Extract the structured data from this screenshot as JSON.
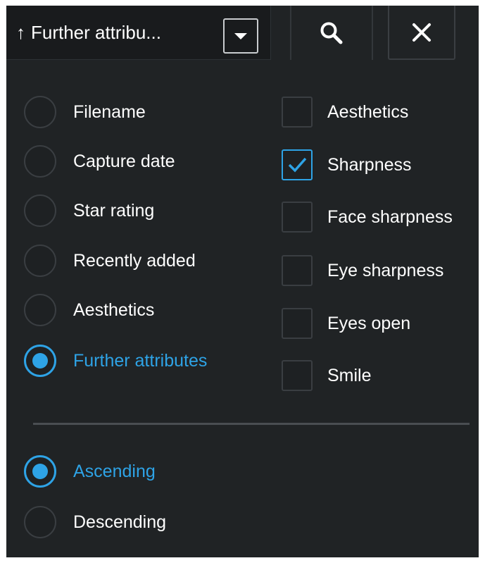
{
  "toolbar": {
    "sort_label": "Further attribu...",
    "arrow_glyph": "↑",
    "search_icon": "search-icon",
    "close_icon": "close-icon"
  },
  "sort_by": {
    "selected": "Further attributes",
    "options": [
      {
        "label": "Filename",
        "checked": false
      },
      {
        "label": "Capture date",
        "checked": false
      },
      {
        "label": "Star rating",
        "checked": false
      },
      {
        "label": "Recently added",
        "checked": false
      },
      {
        "label": "Aesthetics",
        "checked": false
      },
      {
        "label": "Further attributes",
        "checked": true
      }
    ]
  },
  "attributes": {
    "options": [
      {
        "label": "Aesthetics",
        "checked": false
      },
      {
        "label": "Sharpness",
        "checked": true
      },
      {
        "label": "Face sharpness",
        "checked": false
      },
      {
        "label": "Eye sharpness",
        "checked": false
      },
      {
        "label": "Eyes open",
        "checked": false
      },
      {
        "label": "Smile",
        "checked": false
      }
    ]
  },
  "order": {
    "selected": "Ascending",
    "options": [
      {
        "label": "Ascending",
        "checked": true
      },
      {
        "label": "Descending",
        "checked": false
      }
    ]
  },
  "colors": {
    "accent": "#2ea3e6",
    "background": "#202325",
    "toolbar": "#191b1d"
  }
}
